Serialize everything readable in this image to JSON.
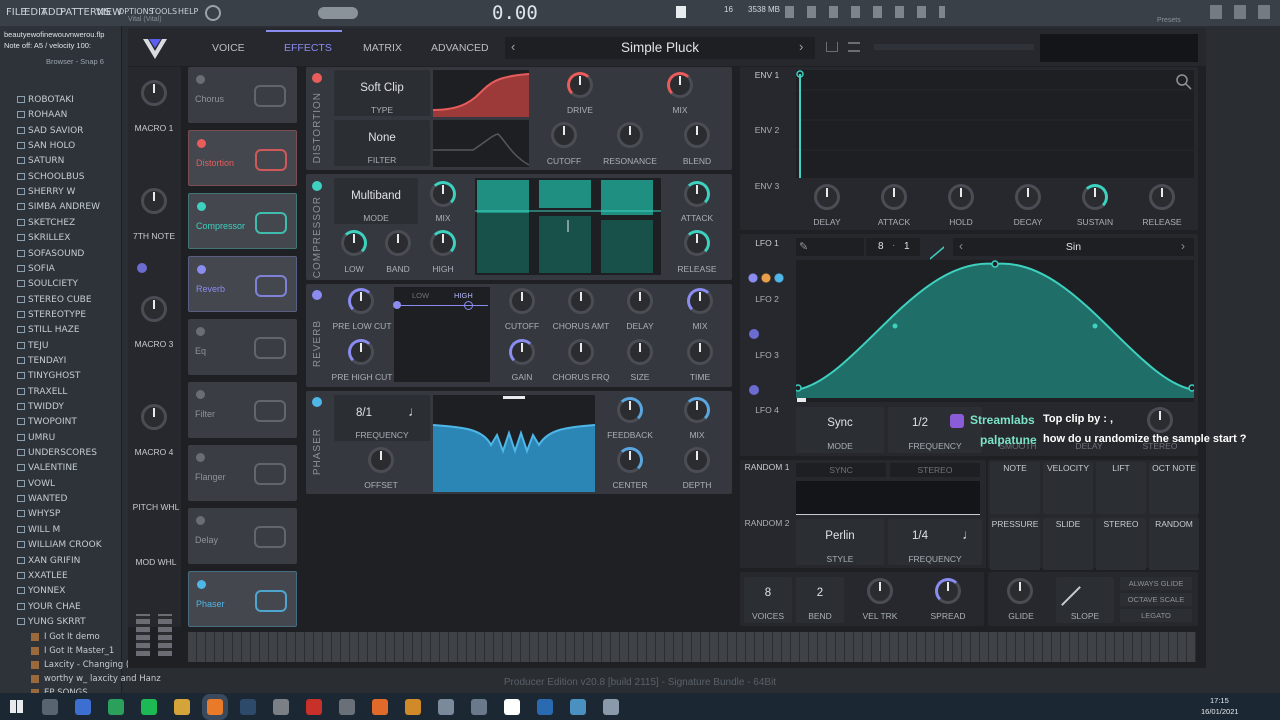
{
  "menubar": {
    "items": [
      "FILE",
      "EDIT",
      "ADD",
      "PATTERNS",
      "VIEW",
      "OPTIONS",
      "TOOLS",
      "HELP"
    ],
    "tempo": "0.00",
    "cpu": "16",
    "mem": "3538 MB"
  },
  "browser": {
    "file_title": "beautyewofinewouvnwerou.flp",
    "note_off": "Note off: A5 / velocity 100:",
    "header": "Browser - Snap 6",
    "items": [
      "ROBOTAKI",
      "ROHAAN",
      "SAD SAVIOR",
      "SAN HOLO",
      "SATURN",
      "SCHOOLBUS",
      "SHERRY W",
      "SIMBA ANDREW",
      "SKETCHEZ",
      "SKRILLEX",
      "SOFASOUND",
      "SOFIA",
      "SOULCIETY",
      "STEREO CUBE",
      "STEREOTYPE",
      "STILL HAZE",
      "TEJU",
      "TENDAYI",
      "TINYGHOST",
      "TRAXELL",
      "TWIDDY",
      "TWOPOINT",
      "UMRU",
      "UNDERSCORES",
      "VALENTINE",
      "VOWL",
      "WANTED",
      "WHYSP",
      "WILL M",
      "WILLIAM CROOK",
      "XAN GRIFIN",
      "XXATLEE",
      "YONNEX",
      "YOUR CHAE",
      "YUNG SKRRT"
    ],
    "files": [
      "I Got It demo",
      "I Got It Master_1",
      "Laxcity - Changing (",
      "worthy w_ laxcity and Hanz",
      "EP SONGS"
    ]
  },
  "vital": {
    "title": "Vital (Vital)",
    "tabs": [
      "VOICE",
      "EFFECTS",
      "MATRIX",
      "ADVANCED"
    ],
    "active_tab": "EFFECTS",
    "preset": "Simple Pluck",
    "macros": [
      "MACRO 1",
      "7TH NOTE",
      "MACRO 3",
      "MACRO 4"
    ],
    "pitch_whl": "PITCH WHL",
    "mod_whl": "MOD WHL",
    "fx_list": [
      {
        "name": "Chorus",
        "on": false
      },
      {
        "name": "Distortion",
        "on": true,
        "color": "#e85c5c"
      },
      {
        "name": "Compressor",
        "on": true,
        "color": "#3ed1c0"
      },
      {
        "name": "Reverb",
        "on": true,
        "color": "#8a8cf0"
      },
      {
        "name": "Eq",
        "on": false
      },
      {
        "name": "Filter",
        "on": false
      },
      {
        "name": "Flanger",
        "on": false
      },
      {
        "name": "Delay",
        "on": false
      },
      {
        "name": "Phaser",
        "on": true,
        "color": "#4fb6e8"
      }
    ],
    "distortion": {
      "section": "DISTORTION",
      "type_value": "Soft Clip",
      "type_label": "TYPE",
      "filter_value": "None",
      "filter_label": "FILTER",
      "knobs": [
        "DRIVE",
        "MIX",
        "CUTOFF",
        "RESONANCE",
        "BLEND"
      ]
    },
    "compressor": {
      "section": "COMPRESSOR",
      "mode_value": "Multiband",
      "mode_label": "MODE",
      "knobs": [
        "MIX",
        "LOW",
        "BAND",
        "HIGH",
        "ATTACK",
        "RELEASE"
      ]
    },
    "reverb": {
      "section": "REVERB",
      "low": "LOW",
      "high": "HIGH",
      "knobs": [
        "PRE LOW CUT",
        "PRE HIGH CUT",
        "CUTOFF",
        "CHORUS AMT",
        "DELAY",
        "MIX",
        "GAIN",
        "CHORUS FRQ",
        "SIZE",
        "TIME"
      ]
    },
    "phaser": {
      "section": "PHASER",
      "frequency_value": "8/1",
      "knobs": [
        "FREQUENCY",
        "OFFSET",
        "FEEDBACK",
        "MIX",
        "CENTER",
        "DEPTH"
      ]
    },
    "env": {
      "labels": [
        "ENV 1",
        "ENV 2",
        "ENV 3"
      ],
      "knobs": [
        "DELAY",
        "ATTACK",
        "HOLD",
        "DECAY",
        "SUSTAIN",
        "RELEASE"
      ]
    },
    "lfo": {
      "labels": [
        "LFO 1",
        "LFO 2",
        "LFO 3",
        "LFO 4"
      ],
      "grid": "8",
      "grid2": "1",
      "shape": "Sin",
      "mode_value": "Sync",
      "mode_label": "MODE",
      "freq_value": "1/2",
      "freq_label": "FREQUENCY",
      "smooth": "SMOOTH",
      "delay": "DELAY",
      "stereo": "STEREO"
    },
    "random": {
      "labels": [
        "RANDOM 1",
        "RANDOM 2"
      ],
      "sync": "SYNC",
      "stereo": "STEREO",
      "style_value": "Perlin",
      "style_label": "STYLE",
      "freq_value": "1/4",
      "freq_label": "FREQUENCY"
    },
    "mod_sources": [
      "NOTE",
      "VELOCITY",
      "LIFT",
      "OCT NOTE",
      "PRESSURE",
      "SLIDE",
      "STEREO",
      "RANDOM"
    ],
    "voice": {
      "voices_value": "8",
      "voices_label": "VOICES",
      "bend_value": "2",
      "bend_label": "BEND",
      "vel_trk": "VEL TRK",
      "spread": "SPREAD",
      "glide": "GLIDE",
      "slope": "SLOPE",
      "always_glide": "ALWAYS GLIDE",
      "octave_scale": "OCTAVE SCALE",
      "legato": "LEGATO"
    },
    "presets_label": "Presets"
  },
  "overlay": {
    "brand": "Streamlabs",
    "user": "palpatune",
    "line1": "Top clip by : ,",
    "line2": "how do u randomize the sample start ?"
  },
  "status_text": "Producer Edition v20.8 [build 2115] - Signature Bundle - 64Bit",
  "taskbar": {
    "time": "17:15",
    "date": "16/01/2021"
  },
  "colors": {
    "red": "#e85c5c",
    "teal": "#3ed1c0",
    "purple": "#8a8cf0",
    "blue": "#4fb6e8"
  }
}
